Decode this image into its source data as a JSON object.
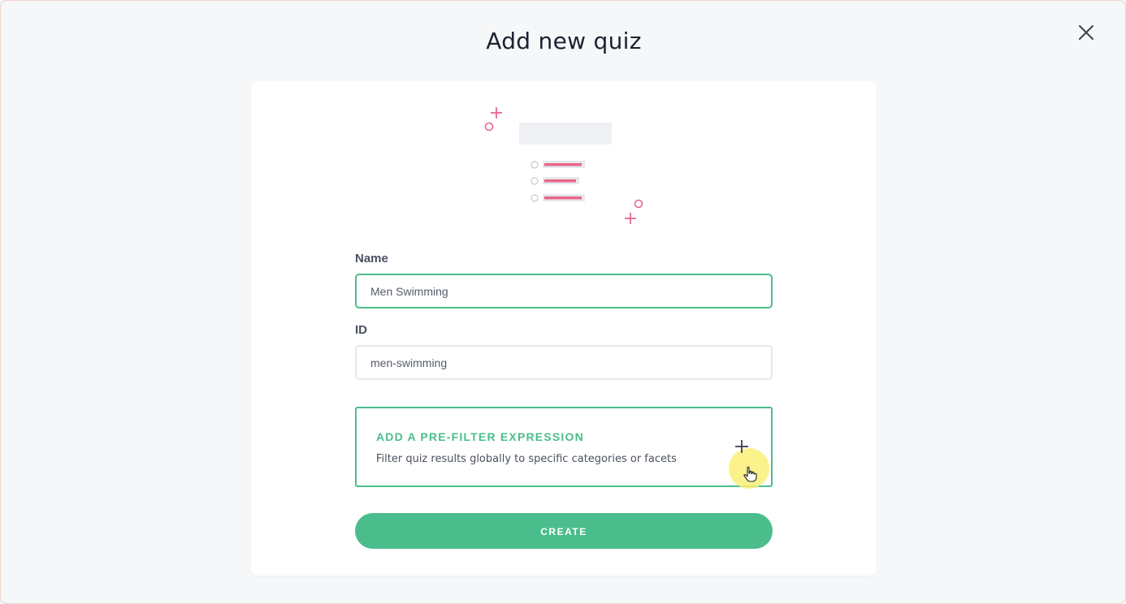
{
  "modal": {
    "title": "Add new quiz"
  },
  "form": {
    "name_label": "Name",
    "name_value": "Men Swimming",
    "id_label": "ID",
    "id_value": "men-swimming"
  },
  "prefilter": {
    "title": "ADD A PRE-FILTER EXPRESSION",
    "description": "Filter quiz results globally to specific categories or facets"
  },
  "actions": {
    "create_label": "CREATE"
  },
  "icons": {
    "close": "close-icon",
    "add": "plus-icon",
    "cursor": "hand-pointer-icon",
    "illustration": "quiz-list-illustration"
  },
  "colors": {
    "accent": "#4bbd8c",
    "illustration_pink": "#e8668a",
    "background": "#f5f7f9"
  }
}
